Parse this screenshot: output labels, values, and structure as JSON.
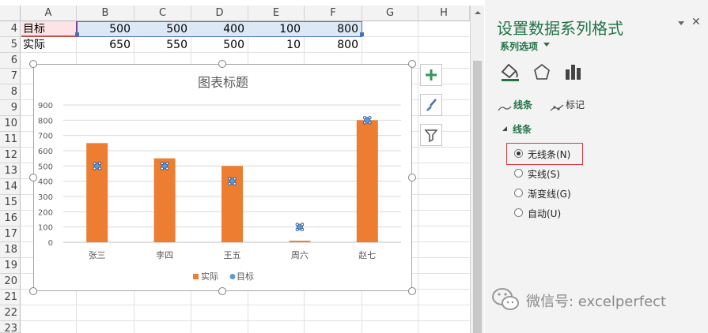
{
  "sheet": {
    "columns": [
      "A",
      "B",
      "C",
      "D",
      "E",
      "F",
      "G",
      "H"
    ],
    "rows": [
      "4",
      "5",
      "6",
      "7",
      "8",
      "9",
      "10",
      "11",
      "12",
      "13",
      "14",
      "15",
      "16",
      "17",
      "18",
      "19",
      "20",
      "21",
      "22",
      "23"
    ],
    "r4": {
      "label": "目标",
      "values": [
        "500",
        "500",
        "400",
        "100",
        "800"
      ]
    },
    "r5": {
      "label": "实际",
      "values": [
        "650",
        "550",
        "500",
        "10",
        "800"
      ]
    }
  },
  "chart_data": {
    "type": "bar",
    "title": "图表标题",
    "categories": [
      "张三",
      "李四",
      "王五",
      "周六",
      "赵七"
    ],
    "series": [
      {
        "name": "实际",
        "type": "bar",
        "values": [
          650,
          550,
          500,
          10,
          800
        ],
        "color": "#ed7d31"
      },
      {
        "name": "目标",
        "type": "scatter",
        "values": [
          500,
          500,
          400,
          100,
          800
        ],
        "color": "#5b9bd5"
      }
    ],
    "ylim": [
      0,
      900
    ],
    "yticks": [
      "0",
      "100",
      "200",
      "300",
      "400",
      "500",
      "600",
      "700",
      "800",
      "900"
    ],
    "grid": true,
    "legend": "bottom"
  },
  "pane": {
    "title": "设置数据系列格式",
    "subtitle": "系列选项",
    "tab_line": "线条",
    "tab_marker": "标记",
    "section": "线条",
    "options": [
      "无线条(N)",
      "实线(S)",
      "渐变线(G)",
      "自动(U)"
    ],
    "selected": 0,
    "close": "✕"
  },
  "watermark": "微信号: excelperfect"
}
